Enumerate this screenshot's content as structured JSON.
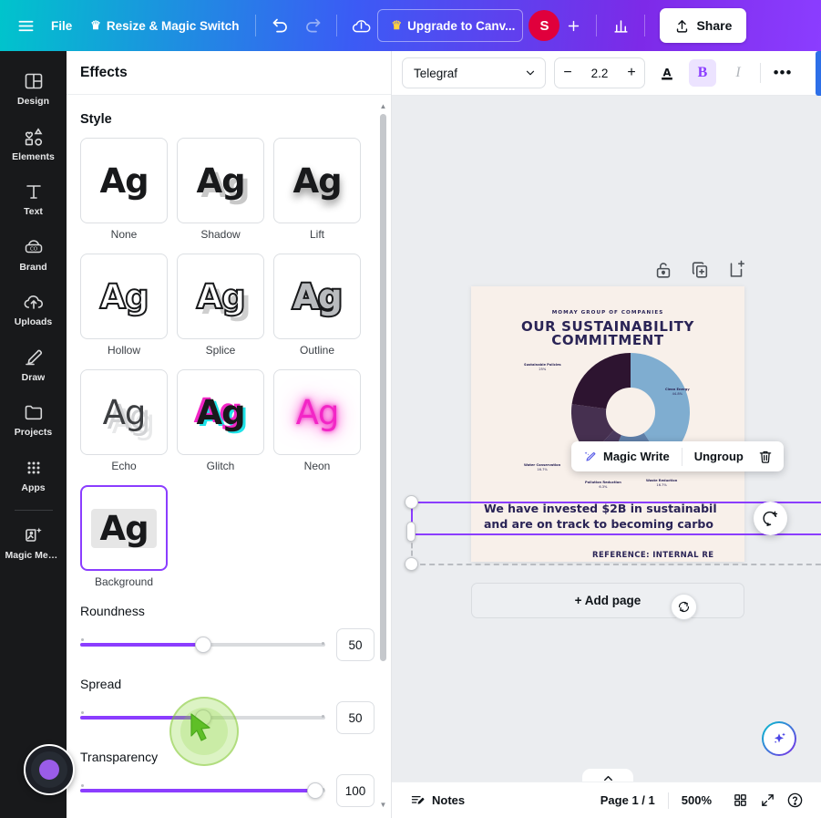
{
  "topbar": {
    "menu_icon": "hamburger-icon",
    "file_label": "File",
    "resize_label": "Resize & Magic Switch",
    "resize_crown": "♛",
    "undo_icon": "undo-icon",
    "redo_icon": "redo-icon",
    "cloud_icon": "cloud-saved-icon",
    "upgrade_label": "Upgrade to Canv...",
    "upgrade_crown": "♛",
    "avatar_initial": "S",
    "add_member_icon": "plus-icon",
    "insights_icon": "bar-chart-icon",
    "share_label": "Share",
    "share_icon": "upload-icon"
  },
  "rail": {
    "items": [
      {
        "label": "Design",
        "icon": "design-icon"
      },
      {
        "label": "Elements",
        "icon": "elements-icon"
      },
      {
        "label": "Text",
        "icon": "text-icon"
      },
      {
        "label": "Brand",
        "icon": "brand-icon"
      },
      {
        "label": "Uploads",
        "icon": "uploads-icon"
      },
      {
        "label": "Draw",
        "icon": "draw-icon"
      },
      {
        "label": "Projects",
        "icon": "projects-icon"
      },
      {
        "label": "Apps",
        "icon": "apps-icon"
      }
    ],
    "magic_media": {
      "label": "Magic Med...",
      "icon": "magic-media-icon"
    }
  },
  "panel": {
    "title": "Effects",
    "style_section": "Style",
    "styles": [
      {
        "label": "None",
        "sample": "Ag",
        "variant": "ag",
        "selected": false
      },
      {
        "label": "Shadow",
        "sample": "Ag",
        "variant": "ag ag-shadow",
        "selected": false
      },
      {
        "label": "Lift",
        "sample": "Ag",
        "variant": "ag ag-lift",
        "selected": false
      },
      {
        "label": "Hollow",
        "sample": "Ag",
        "variant": "ag ag-hollow",
        "selected": false
      },
      {
        "label": "Splice",
        "sample": "Ag",
        "variant": "ag ag-splice",
        "selected": false
      },
      {
        "label": "Outline",
        "sample": "Ag",
        "variant": "ag ag-outline",
        "selected": false
      },
      {
        "label": "Echo",
        "sample": "Ag",
        "variant": "ag ag-echo",
        "selected": false
      },
      {
        "label": "Glitch",
        "sample": "Ag",
        "variant": "ag ag-glitch",
        "selected": false
      },
      {
        "label": "Neon",
        "sample": "Ag",
        "variant": "ag ag-neon",
        "selected": false
      },
      {
        "label": "Background",
        "sample": "Ag",
        "variant": "ag ag-bg-chip",
        "selected": true
      }
    ],
    "sliders": [
      {
        "label": "Roundness",
        "value": "50",
        "pct": 50
      },
      {
        "label": "Spread",
        "value": "50",
        "pct": 50
      },
      {
        "label": "Transparency",
        "value": "100",
        "pct": 96
      }
    ]
  },
  "doc_toolbar": {
    "font_name": "Telegraf",
    "font_chevron": "chevron-down-icon",
    "size_minus": "−",
    "size_value": "2.2",
    "size_plus": "+",
    "text_color_icon": "text-color-icon",
    "bold_label": "B",
    "italic_label": "I",
    "more_label": "•••"
  },
  "element_controls": [
    {
      "icon": "lock-icon",
      "name": "lock-element-button"
    },
    {
      "icon": "duplicate-icon",
      "name": "duplicate-element-button"
    },
    {
      "icon": "add-page-icon",
      "name": "add-page-after-button"
    }
  ],
  "design": {
    "brand": "MOMAY GROUP OF COMPANIES",
    "title_line1": "OUR SUSTAINABILITY",
    "title_line2": "COMMITMENT",
    "body": "We have invested $2B in sustainabil… and are on track to becoming carbo…",
    "body_line1": "We have invested $2B in sustainabil",
    "body_line2": "and are on track to becoming carbo",
    "reference": "REFERENCE: INTERNAL RE"
  },
  "chart_data": {
    "type": "pie",
    "title": "OUR SUSTAINABILITY COMMITMENT",
    "subtitle": "MOMAY GROUP OF COMPANIES",
    "donut": true,
    "categories": [
      "Clean Energy",
      "Waste Reduction",
      "Pollution Reduction",
      "Water Conservation",
      "Sustainable Policies"
    ],
    "values": [
      44.8,
      16.7,
      6.3,
      16.7,
      25.0
    ],
    "labels": [
      "44.8%",
      "16.7%",
      "6.3%",
      "16.7%",
      "25%"
    ],
    "colors": [
      "#7fadd0",
      "#5f7fa8",
      "#4b3a5e",
      "#463050",
      "#2d1430"
    ],
    "legend": "labels-outside"
  },
  "magic_bar": {
    "magic_write_label": "Magic Write",
    "magic_write_icon": "magic-pen-icon",
    "ungroup_label": "Ungroup",
    "delete_icon": "trash-icon"
  },
  "comment_fab": {
    "icon": "add-comment-icon"
  },
  "add_page": {
    "label": "+ Add page",
    "refresh_icon": "refresh-icon"
  },
  "ai_fab": {
    "icon": "sparkle-icon"
  },
  "collapse_tab": {
    "icon": "chevron-up-icon"
  },
  "bottombar": {
    "notes_label": "Notes",
    "notes_icon": "notes-icon",
    "page_label": "Page 1 / 1",
    "zoom_label": "500%",
    "grid_icon": "grid-view-icon",
    "fullscreen_icon": "fullscreen-icon",
    "help_icon": "help-icon"
  },
  "recorder": {
    "name": "screen-recorder-widget"
  },
  "colors": {
    "accent_purple": "#8b3dff",
    "brand_teal": "#00c4cc",
    "avatar_red": "#e0003c",
    "canvas_bg": "#ebedf0",
    "page_bg": "#f8f0ea",
    "ink_navy": "#2a2456"
  }
}
